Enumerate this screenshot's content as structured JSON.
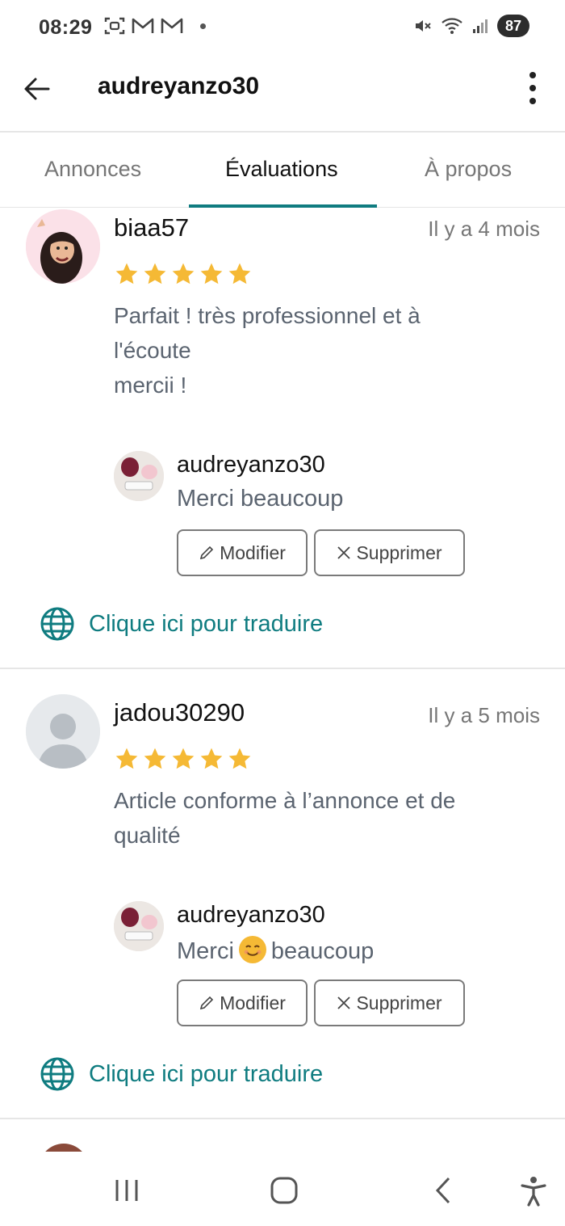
{
  "status_bar": {
    "time": "08:29",
    "battery": "87"
  },
  "header": {
    "title": "audreyanzo30"
  },
  "tabs": [
    {
      "label": "Annonces"
    },
    {
      "label": "Évaluations"
    },
    {
      "label": "À propos"
    }
  ],
  "reviews": [
    {
      "username": "biaa57",
      "date": "Il y a 4 mois",
      "rating": 5,
      "text": "Parfait ! très professionnel et à\nl'écoute\nmercii !",
      "reply": {
        "username": "audreyanzo30",
        "text": "Merci beaucoup",
        "edit_label": "Modifier",
        "delete_label": "Supprimer"
      },
      "translate_label": "Clique ici pour traduire"
    },
    {
      "username": "jadou30290",
      "date": "Il y a 5 mois",
      "rating": 5,
      "text": "Article conforme à l’annonce et de\nqualité",
      "reply": {
        "username": "audreyanzo30",
        "text_before": "Merci",
        "text_after": "beaucoup",
        "edit_label": "Modifier",
        "delete_label": "Supprimer"
      },
      "translate_label": "Clique ici pour traduire"
    }
  ],
  "colors": {
    "accent": "#0f7c80",
    "star": "#f5b935"
  }
}
